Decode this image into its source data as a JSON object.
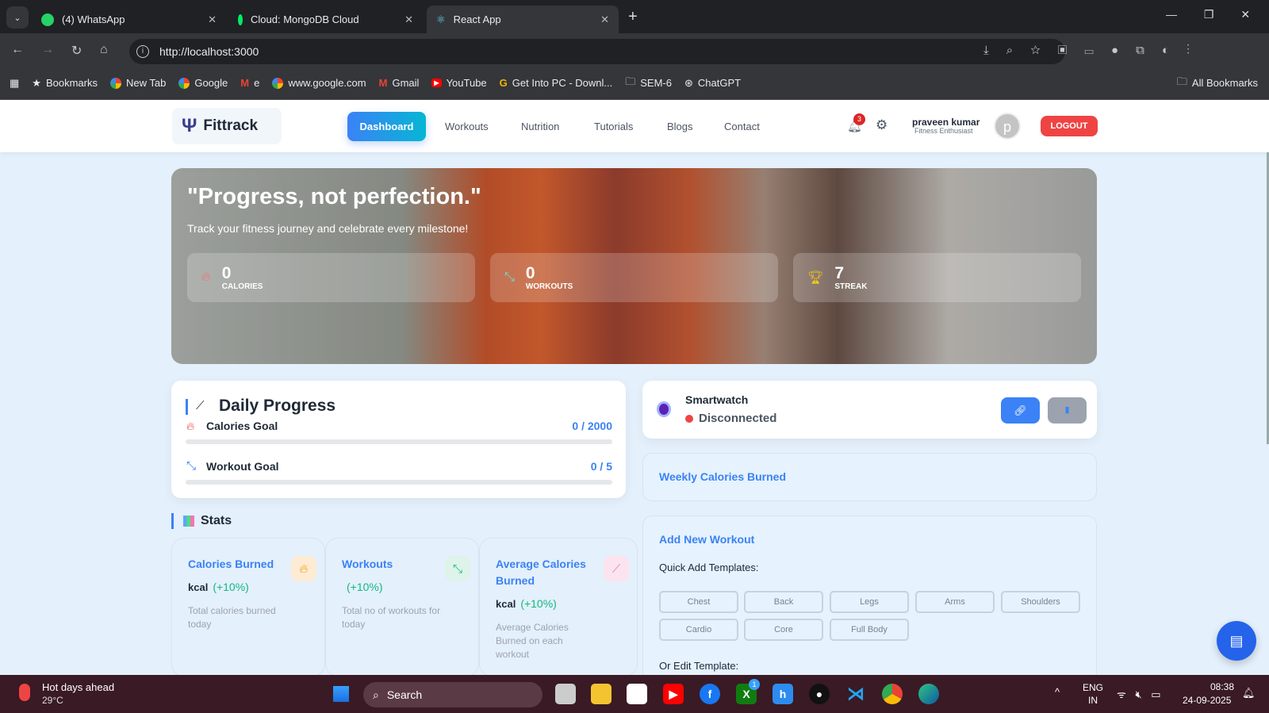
{
  "browser": {
    "tabs": [
      {
        "title": "(4) WhatsApp"
      },
      {
        "title": "Cloud: MongoDB Cloud"
      },
      {
        "title": "React App"
      }
    ],
    "url": "http://localhost:3000",
    "bookmarks": [
      "Bookmarks",
      "New Tab",
      "Google",
      "e",
      "www.google.com",
      "Gmail",
      "YouTube",
      "Get Into PC - Downl...",
      "SEM-6",
      "ChatGPT"
    ],
    "all_bookmarks": "All Bookmarks"
  },
  "nav": {
    "brand": "Fittrack",
    "links": [
      "Dashboard",
      "Workouts",
      "Nutrition",
      "Tutorials",
      "Blogs",
      "Contact"
    ],
    "notifications": "3",
    "user_name": "praveen kumar",
    "user_role": "Fitness Enthusiast",
    "avatar_letter": "p",
    "logout": "LOGOUT"
  },
  "hero": {
    "quote": "\"Progress, not perfection.\"",
    "subtitle": "Track your fitness journey and celebrate every milestone!",
    "stats": [
      {
        "value": "0",
        "label": "CALORIES"
      },
      {
        "value": "0",
        "label": "WORKOUTS"
      },
      {
        "value": "7",
        "label": "STREAK"
      }
    ]
  },
  "daily": {
    "title": "Daily Progress",
    "calories_label": "Calories Goal",
    "calories_value": "0 / 2000",
    "calories_progress": 0,
    "workout_label": "Workout Goal",
    "workout_value": "0 / 5",
    "workout_progress": 0
  },
  "smartwatch": {
    "title": "Smartwatch",
    "status": "Disconnected",
    "status_color": "#ef4444"
  },
  "weekly": {
    "title": "Weekly Calories Burned"
  },
  "stats": {
    "title": "Stats",
    "cards": [
      {
        "title": "Calories Burned",
        "unit": "kcal",
        "change": "(+10%)",
        "desc": "Total calories burned today"
      },
      {
        "title": "Workouts",
        "unit": "",
        "change": "(+10%)",
        "desc": "Total no of workouts for today"
      },
      {
        "title": "Average Calories Burned",
        "unit": "kcal",
        "change": "(+10%)",
        "desc": "Average Calories Burned on each workout"
      }
    ]
  },
  "add_workout": {
    "title": "Add New Workout",
    "quick_label": "Quick Add Templates:",
    "templates": [
      "Chest",
      "Back",
      "Legs",
      "Arms",
      "Shoulders",
      "Cardio",
      "Core",
      "Full Body"
    ],
    "edit_label": "Or Edit Template:"
  },
  "taskbar": {
    "weather_title": "Hot days ahead",
    "weather_temp": "29°C",
    "search": "Search",
    "xbox_badge": "1",
    "lang1": "ENG",
    "lang2": "IN",
    "time": "08:38",
    "date": "24-09-2025"
  }
}
